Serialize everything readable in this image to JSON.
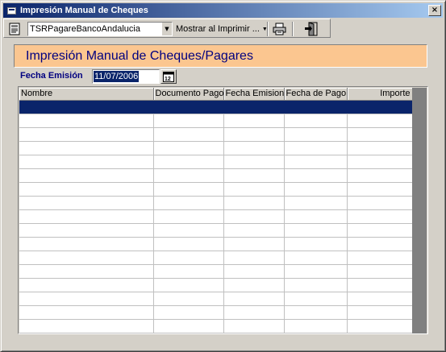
{
  "window": {
    "title": "Impresión Manual de Cheques",
    "close_glyph": "×",
    "icons": [
      "window-icon",
      "close-icon"
    ]
  },
  "toolbar": {
    "report_combo_value": "TSRPagareBancoAndalucia",
    "combo_arrow": "▼",
    "show_print_label": "Mostrar al Imprimir ...",
    "dropdown_arrow": "▼",
    "icons": [
      "report-icon",
      "printer-icon",
      "exit-icon"
    ]
  },
  "header": {
    "banner_title": "Impresión Manual de Cheques/Pagares",
    "banner_color": "#fbc690",
    "banner_text_color": "#000080"
  },
  "form": {
    "fecha_label": "Fecha Emisión",
    "fecha_value": "11/07/2006",
    "calendar_icon": "calendar-icon"
  },
  "grid": {
    "columns": [
      "Nombre",
      "Documento Pago",
      "Fecha Emision",
      "Fecha de Pago",
      "Importe"
    ],
    "rows": [
      [
        "",
        "",
        "",
        "",
        ""
      ],
      [
        "",
        "",
        "",
        "",
        ""
      ],
      [
        "",
        "",
        "",
        "",
        ""
      ],
      [
        "",
        "",
        "",
        "",
        ""
      ],
      [
        "",
        "",
        "",
        "",
        ""
      ],
      [
        "",
        "",
        "",
        "",
        ""
      ],
      [
        "",
        "",
        "",
        "",
        ""
      ],
      [
        "",
        "",
        "",
        "",
        ""
      ],
      [
        "",
        "",
        "",
        "",
        ""
      ],
      [
        "",
        "",
        "",
        "",
        ""
      ],
      [
        "",
        "",
        "",
        "",
        ""
      ],
      [
        "",
        "",
        "",
        "",
        ""
      ],
      [
        "",
        "",
        "",
        "",
        ""
      ],
      [
        "",
        "",
        "",
        "",
        ""
      ],
      [
        "",
        "",
        "",
        "",
        ""
      ],
      [
        "",
        "",
        "",
        "",
        ""
      ],
      [
        "",
        "",
        "",
        "",
        ""
      ]
    ],
    "selected_row": 0,
    "selection_color": "#0a246a"
  }
}
